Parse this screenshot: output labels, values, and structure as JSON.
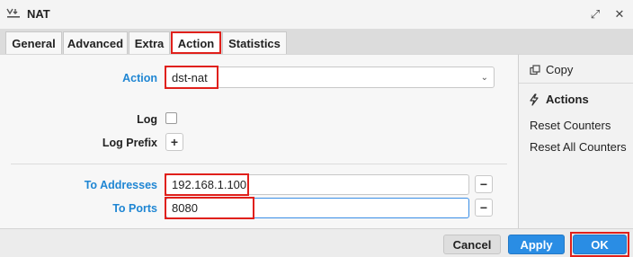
{
  "window": {
    "title": "NAT",
    "restore_glyph": "⤢",
    "close_glyph": "✕"
  },
  "tabs": [
    {
      "label": "General"
    },
    {
      "label": "Advanced"
    },
    {
      "label": "Extra"
    },
    {
      "label": "Action"
    },
    {
      "label": "Statistics"
    }
  ],
  "active_tab": "Action",
  "form": {
    "action_label": "Action",
    "action_value": "dst-nat",
    "log_label": "Log",
    "log_checked": false,
    "log_prefix_label": "Log Prefix",
    "add_glyph": "+",
    "to_addresses_label": "To Addresses",
    "to_addresses_value": "192.168.1.100",
    "to_ports_label": "To Ports",
    "to_ports_value": "8080",
    "remove_glyph": "−"
  },
  "sidebar": {
    "copy_label": "Copy",
    "actions_heading": "Actions",
    "reset_counters": "Reset Counters",
    "reset_all_counters": "Reset All Counters"
  },
  "footer": {
    "cancel_label": "Cancel",
    "apply_label": "Apply",
    "ok_label": "OK"
  },
  "colors": {
    "accent": "#2a8de4",
    "label_blue": "#1f86d3",
    "highlight": "#e0201b"
  },
  "icons": {
    "app": "nat-icon",
    "copy": "copy-icon",
    "actions": "lightning-icon"
  }
}
